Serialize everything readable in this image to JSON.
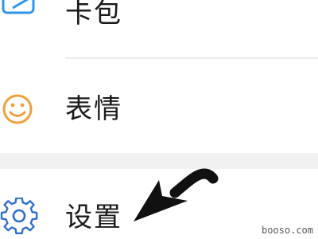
{
  "menu": {
    "items": [
      {
        "label": "卡包",
        "icon": "wallet-icon",
        "icon_color": "#2f97e6"
      },
      {
        "label": "表情",
        "icon": "smiley-icon",
        "icon_color": "#f0a03c"
      },
      {
        "label": "设置",
        "icon": "gear-icon",
        "icon_color": "#2f6fd0"
      }
    ]
  },
  "colors": {
    "background": "#ffffff",
    "divider": "#ececec",
    "section_gap": "#f1f1f1",
    "label_text": "#1a1a1a",
    "arrow": "#111111"
  },
  "annotation": {
    "arrow_icon": "pointer-arrow-icon",
    "watermark": "booso.com"
  }
}
